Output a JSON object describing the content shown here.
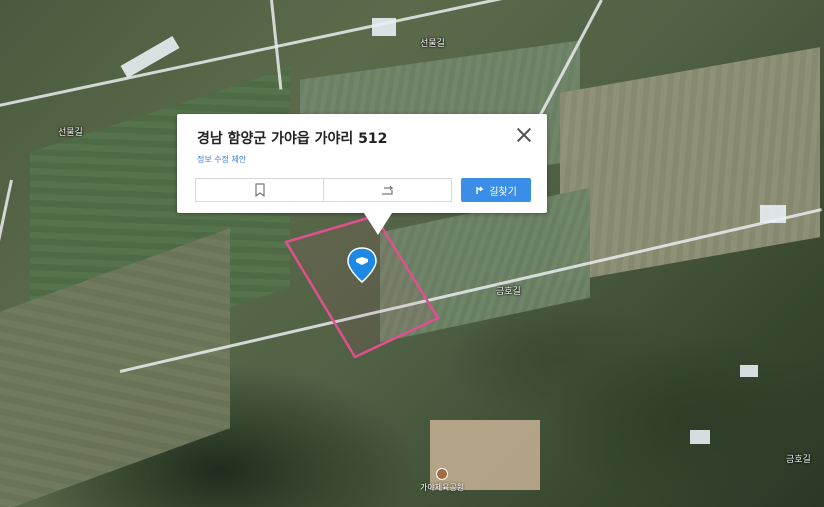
{
  "popup": {
    "title": "경남 함양군 가야읍 가야리 512",
    "suggest_link": "정보 수정 제안",
    "route_button": "길찾기"
  },
  "road_labels": [
    "선물길",
    "선물길",
    "금호길",
    "금호길"
  ],
  "facility_label": "가야체육공원",
  "colors": {
    "parcel_outline": "#e0508f",
    "pin": "#1e88e5",
    "route_button": "#3a8ee8",
    "suggest_link": "#3b7cd9"
  },
  "icons": [
    "close-icon",
    "bookmark-icon",
    "share-icon",
    "route-icon",
    "location-pin-icon",
    "facility-icon"
  ]
}
